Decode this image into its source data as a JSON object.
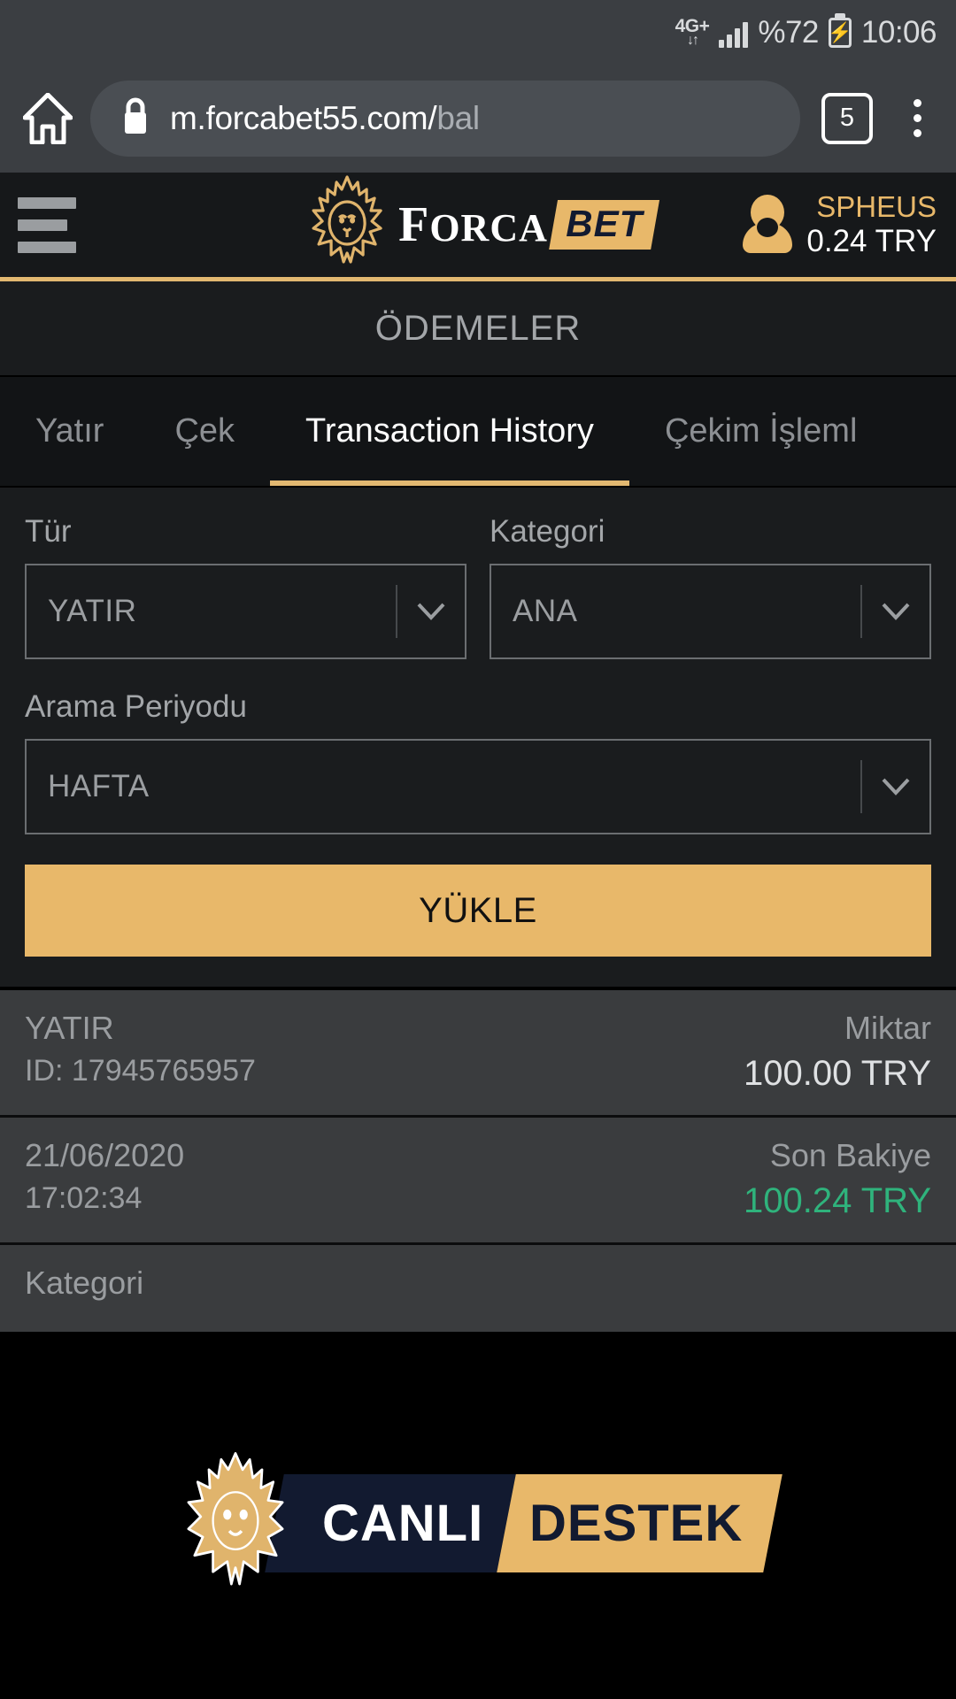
{
  "statusbar": {
    "network_label": "4G+",
    "network_arrows": "↓↑",
    "battery_percent": "%72",
    "battery_icon": "charging-bolt-icon",
    "clock": "10:06"
  },
  "browser": {
    "home_icon": "home-icon",
    "lock_icon": "lock-icon",
    "url_visible": "m.forcabet55.com/",
    "url_dimmed": "bal",
    "tab_count": "5",
    "menu_icon": "kebab-menu-icon"
  },
  "site_header": {
    "menu_icon": "hamburger-icon",
    "logo_lion": "lion-logo-icon",
    "logo_word_f": "F",
    "logo_word_rest": "ORCA",
    "logo_badge": "BET",
    "username": "SPHEUS",
    "balance": "0.24 TRY",
    "accent_color": "#e2b871"
  },
  "page": {
    "title": "ÖDEMELER"
  },
  "tabs": [
    {
      "label": "Yatır",
      "active": false
    },
    {
      "label": "Çek",
      "active": false
    },
    {
      "label": "Transaction History",
      "active": true
    },
    {
      "label": "Çekim İşleml",
      "active": false
    }
  ],
  "filters": {
    "tur": {
      "label": "Tür",
      "value": "YATIR"
    },
    "kategori": {
      "label": "Kategori",
      "value": "ANA"
    },
    "arama_periyodu": {
      "label": "Arama Periyodu",
      "value": "HAFTA"
    },
    "submit_label": "YÜKLE"
  },
  "transactions": [
    {
      "type": "YATIR",
      "id": "ID: 17945765957",
      "amount_label": "Miktar",
      "amount": "100.00 TRY"
    },
    {
      "date": "21/06/2020",
      "time": "17:02:34",
      "balance_label": "Son Bakiye",
      "balance": "100.24 TRY",
      "balance_color": "#2fb37c"
    },
    {
      "category_label": "Kategori"
    }
  ],
  "footer": {
    "support_lion": "lion-logo-icon",
    "support_word_1": "CANLI",
    "support_word_2": "DESTEK"
  }
}
